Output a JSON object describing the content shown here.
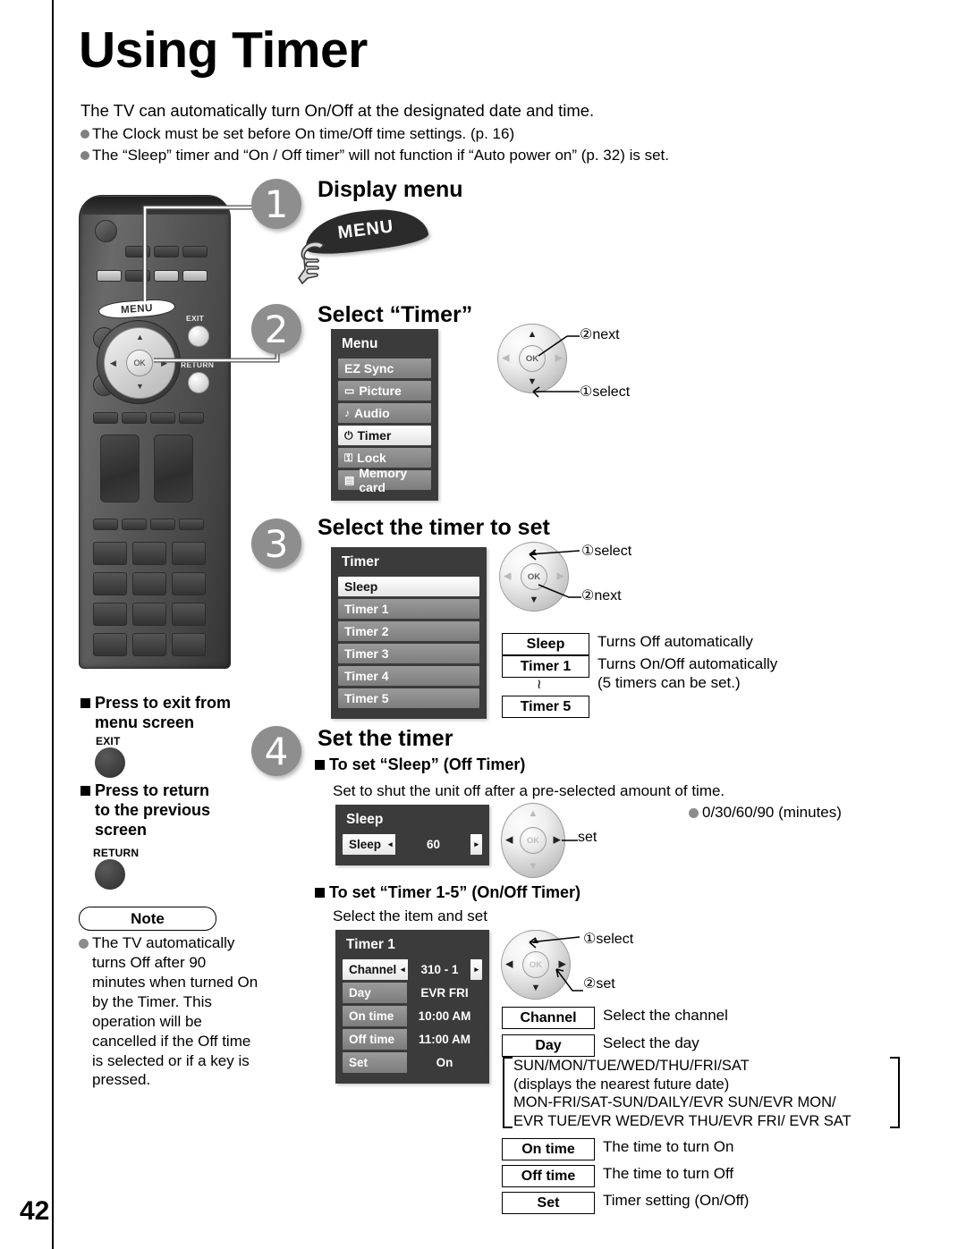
{
  "page": {
    "title": "Using Timer",
    "number": "42"
  },
  "intro": {
    "lead": "The TV can automatically turn On/Off at the designated date and time.",
    "bullets": [
      "The Clock must be set before On time/Off time settings. (p. 16)",
      "The “Sleep” timer and “On / Off timer” will not function if “Auto power on” (p. 32) is set."
    ]
  },
  "steps": [
    {
      "num": "1",
      "heading": "Display menu"
    },
    {
      "num": "2",
      "heading": "Select “Timer”"
    },
    {
      "num": "3",
      "heading": "Select the timer to set"
    },
    {
      "num": "4",
      "heading": "Set the timer"
    }
  ],
  "remote": {
    "menu_key": "MENU",
    "ok_key": "OK",
    "exit_key": "EXIT",
    "return_key": "RETURN"
  },
  "menu_banner": {
    "label": "MENU"
  },
  "menu_osd": {
    "title": "Menu",
    "items": [
      {
        "label": "EZ Sync",
        "icon": "",
        "selected": false
      },
      {
        "label": "Picture",
        "icon": "▭",
        "selected": false
      },
      {
        "label": "Audio",
        "icon": "♪",
        "selected": false
      },
      {
        "label": "Timer",
        "icon": "⏻",
        "selected": true
      },
      {
        "label": "Lock",
        "icon": "⚿",
        "selected": false
      },
      {
        "label": "Memory card",
        "icon": "▤",
        "selected": false
      }
    ]
  },
  "timer_osd": {
    "title": "Timer",
    "items": [
      {
        "label": "Sleep",
        "selected": true
      },
      {
        "label": "Timer 1",
        "selected": false
      },
      {
        "label": "Timer 2",
        "selected": false
      },
      {
        "label": "Timer 3",
        "selected": false
      },
      {
        "label": "Timer 4",
        "selected": false
      },
      {
        "label": "Timer 5",
        "selected": false
      }
    ]
  },
  "navpads": {
    "step2": {
      "ok": "OK",
      "c1": "①select",
      "c2": "②next"
    },
    "step3": {
      "ok": "OK",
      "c1": "①select",
      "c2": "②next"
    },
    "sleep": {
      "ok": "OK",
      "c1": "set"
    },
    "timer1": {
      "ok": "OK",
      "c1": "①select",
      "c2": "②set"
    }
  },
  "timer_legend": {
    "sleep_key": "Sleep",
    "sleep_desc": "Turns Off automatically",
    "timer1_key": "Timer 1",
    "timer_desc_line1": "Turns On/Off automatically",
    "timer_desc_line2": "(5 timers can be set.)",
    "ellipsis": "≀",
    "timer5_key": "Timer 5"
  },
  "sleep_section": {
    "heading": "To set “Sleep” (Off Timer)",
    "description": "Set to shut the unit off after a pre-selected amount of time.",
    "options_note": "0/30/60/90 (minutes)",
    "panel": {
      "title": "Sleep",
      "row_key": "Sleep",
      "row_value": "60"
    }
  },
  "timer_section": {
    "heading": "To set “Timer 1-5” (On/Off Timer)",
    "subtext": "Select the item and set",
    "panel": {
      "title": "Timer 1",
      "rows": [
        {
          "key": "Channel",
          "value": "310 - 1",
          "selected": true
        },
        {
          "key": "Day",
          "value": "EVR FRI",
          "selected": false
        },
        {
          "key": "On time",
          "value": "10:00 AM",
          "selected": false
        },
        {
          "key": "Off time",
          "value": "11:00 AM",
          "selected": false
        },
        {
          "key": "Set",
          "value": "On",
          "selected": false
        }
      ]
    },
    "legend": [
      {
        "key": "Channel",
        "desc": "Select the channel"
      },
      {
        "key": "Day",
        "desc": "Select the day"
      },
      {
        "key": "On time",
        "desc": "The time to turn On"
      },
      {
        "key": "Off time",
        "desc": "The time to turn Off"
      },
      {
        "key": "Set",
        "desc": "Timer setting (On/Off)"
      }
    ],
    "day_options": [
      "SUN/MON/TUE/WED/THU/FRI/SAT",
      "(displays the nearest future date)",
      "MON-FRI/SAT-SUN/DAILY/EVR SUN/EVR MON/",
      "EVR TUE/EVR WED/EVR THU/EVR FRI/ EVR SAT"
    ]
  },
  "left_column": {
    "exit_heading_l1": "Press to exit from",
    "exit_heading_l2": "menu screen",
    "exit_key": "EXIT",
    "return_heading_l1": "Press to return",
    "return_heading_l2": "to the previous",
    "return_heading_l3": "screen",
    "return_key": "RETURN",
    "note_caption": "Note",
    "note_text": "The TV automatically turns Off after 90 minutes when turned On by the Timer. This operation will be cancelled if the Off time is selected or if a key is pressed."
  }
}
